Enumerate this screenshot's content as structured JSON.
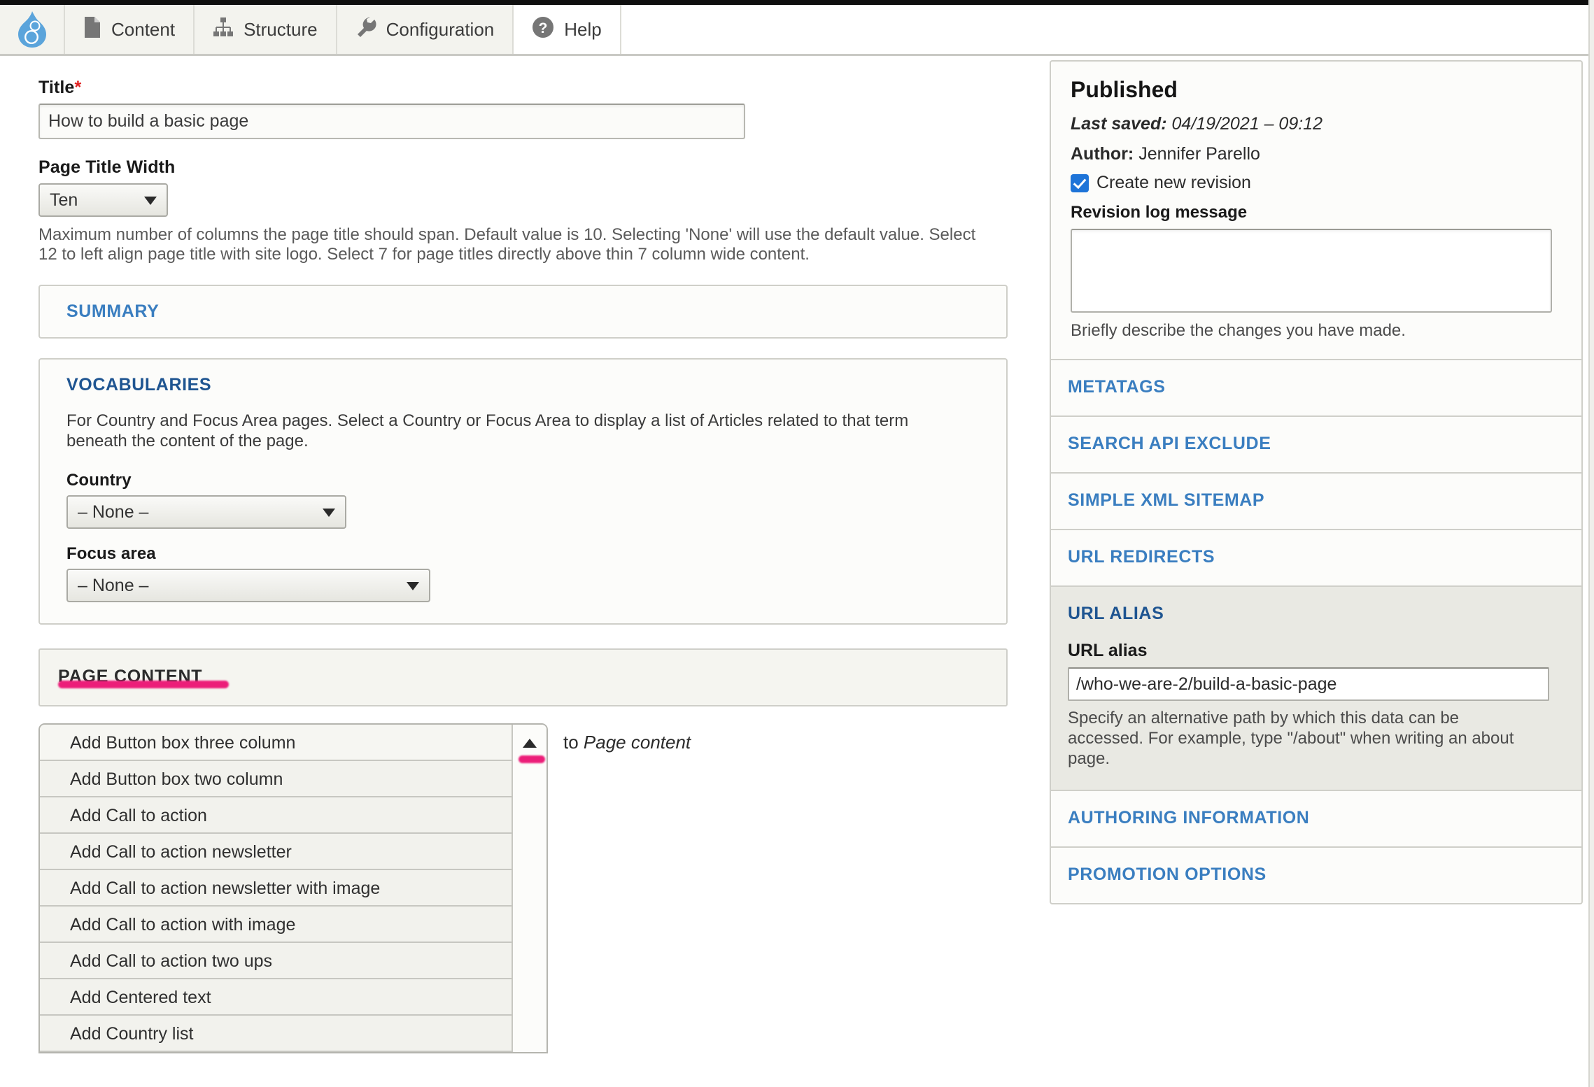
{
  "toolbar": {
    "logo_name": "drupal-logo",
    "items": [
      {
        "label": "Content",
        "icon": "document-icon",
        "active": false
      },
      {
        "label": "Structure",
        "icon": "sitemap-icon",
        "active": false
      },
      {
        "label": "Configuration",
        "icon": "wrench-icon",
        "active": false
      },
      {
        "label": "Help",
        "icon": "help-icon",
        "active": true
      }
    ]
  },
  "form": {
    "title_label": "Title",
    "title_required_mark": "*",
    "title_value": "How to build a basic page",
    "page_title_width_label": "Page Title Width",
    "page_title_width_value": "Ten",
    "page_title_width_help": "Maximum number of columns the page title should span. Default value is 10. Selecting 'None' will use the default value. Select 12 to left align page title with site logo. Select 7 for page titles directly above thin 7 column wide content."
  },
  "summary_panel": {
    "heading": "SUMMARY"
  },
  "vocabularies_panel": {
    "heading": "VOCABULARIES",
    "description": "For Country and Focus Area pages. Select a Country or Focus Area to display a list of Articles related to that term beneath the content of the page.",
    "country_label": "Country",
    "country_value": "– None –",
    "focus_area_label": "Focus area",
    "focus_area_value": "– None –"
  },
  "page_content": {
    "heading": "PAGE CONTENT",
    "add_to_text_prefix": "to ",
    "add_to_text_target": "Page content",
    "options": [
      "Add Button box three column",
      "Add Button box two column",
      "Add Call to action",
      "Add Call to action newsletter",
      "Add Call to action newsletter with image",
      "Add Call to action with image",
      "Add Call to action two ups",
      "Add Centered text",
      "Add Country list"
    ]
  },
  "sidebar": {
    "published": {
      "status": "Published",
      "last_saved_label": "Last saved:",
      "last_saved_value": "04/19/2021 – 09:12",
      "author_label": "Author:",
      "author_value": "Jennifer Parello",
      "create_new_revision_label": "Create new revision",
      "create_new_revision_checked": true,
      "revision_log_label": "Revision log message",
      "revision_log_value": "",
      "revision_log_help": "Briefly describe the changes you have made."
    },
    "sections": [
      {
        "label": "METATAGS",
        "open": false
      },
      {
        "label": "SEARCH API EXCLUDE",
        "open": false
      },
      {
        "label": "SIMPLE XML SITEMAP",
        "open": false
      },
      {
        "label": "URL REDIRECTS",
        "open": false
      }
    ],
    "url_alias": {
      "heading": "URL ALIAS",
      "field_label": "URL alias",
      "value": "/who-we-are-2/build-a-basic-page",
      "help": "Specify an alternative path by which this data can be accessed. For example, type \"/about\" when writing an about page."
    },
    "sections_bottom": [
      {
        "label": "AUTHORING INFORMATION",
        "open": false
      },
      {
        "label": "PROMOTION OPTIONS",
        "open": false
      }
    ]
  },
  "annotations": {
    "highlight_color": "#ec1e79",
    "marks": [
      "page-content-underline",
      "scroll-up-arrow-mark"
    ]
  },
  "colors": {
    "link_blue": "#3a7ec0",
    "link_blue_dark": "#1f5591",
    "drupal_blue": "#5ba4db",
    "required_red": "#e02020",
    "checkbox_blue": "#1e74d8"
  }
}
